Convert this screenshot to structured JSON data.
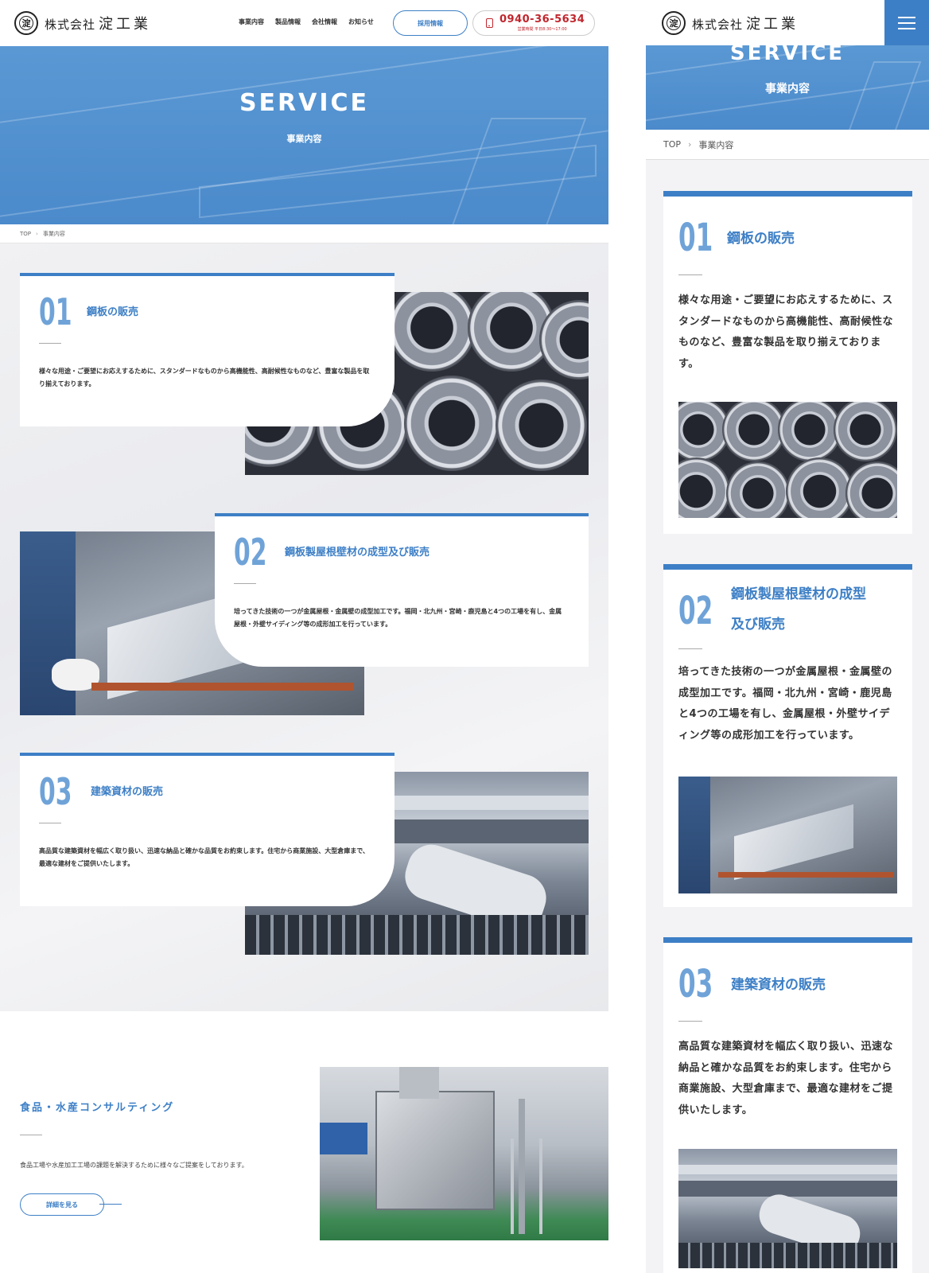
{
  "brand": {
    "logo_mark": "淀",
    "company_prefix": "株式会社",
    "company_name": "淀工業"
  },
  "nav": {
    "items": [
      "事業内容",
      "製品情報",
      "会社情報",
      "お知らせ"
    ],
    "recruit_label": "採用情報"
  },
  "phone": {
    "number": "0940-36-5634",
    "hours": "営業時間 平日8:30〜17:00"
  },
  "hero": {
    "title": "SERVICE",
    "subtitle": "事業内容"
  },
  "breadcrumb": {
    "home": "TOP",
    "separator": "›",
    "current": "事業内容"
  },
  "services": [
    {
      "number": "01",
      "title": "鋼板の販売",
      "mobile_title_lines": [
        "鋼板の販売"
      ],
      "description": "様々な用途・ご要望にお応えするために、スタンダードなものから高機能性、高耐候性なものなど、豊富な製品を取り揃えております。",
      "photo": "steel-coils-photo"
    },
    {
      "number": "02",
      "title": "鋼板製屋根壁材の成型及び販売",
      "mobile_title_lines": [
        "鋼板製屋根壁材の成型",
        "及び販売"
      ],
      "description": "培ってきた技術の一つが金属屋根・金属壁の成型加工です。福岡・北九州・宮崎・鹿児島と4つの工場を有し、金属屋根・外壁サイディング等の成形加工を行っています。",
      "photo": "roof-panel-forming-photo"
    },
    {
      "number": "03",
      "title": "建築資材の販売",
      "mobile_title_lines": [
        "建築資材の販売"
      ],
      "description": "高品質な建築資材を幅広く取り扱い、迅速な納品と確かな品質をお約束します。住宅から商業施設、大型倉庫まで、最適な建材をご提供いたします。",
      "photo": "building-material-photo"
    }
  ],
  "food_consulting": {
    "title": "食品・水産コンサルティング",
    "description": "食品工場や水産加工工場の課題を解決するために様々なご提案をしております。",
    "button_label": "詳細を見る",
    "photo": "food-processing-machine-photo"
  },
  "icons": {
    "phone": "phone-icon",
    "menu": "hamburger-menu-icon",
    "logo": "logo-seal-icon"
  },
  "colors": {
    "accent": "#3d7fc6",
    "number": "#6fa3d8",
    "phone": "#c0262d",
    "hero": "#4b8acb"
  }
}
